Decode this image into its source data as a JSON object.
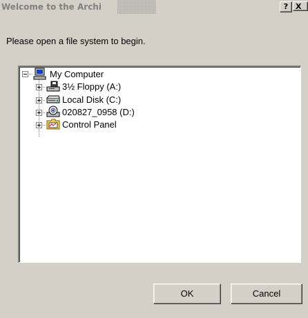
{
  "window": {
    "title": "Welcome to the Archi",
    "help_label": "?",
    "close_label": "X"
  },
  "prompt": "Please open a file system to begin.",
  "tree": {
    "root": {
      "label": "My Computer",
      "icon": "computer-icon",
      "expanded": true
    },
    "children": [
      {
        "label": "3½ Floppy (A:)",
        "icon": "floppy-drive-icon"
      },
      {
        "label": "Local Disk (C:)",
        "icon": "hard-disk-icon"
      },
      {
        "label": "020827_0958 (D:)",
        "icon": "cd-drive-icon"
      },
      {
        "label": "Control Panel",
        "icon": "control-panel-icon"
      }
    ]
  },
  "buttons": {
    "ok": "OK",
    "cancel": "Cancel"
  },
  "colors": {
    "face": "#d4d0c8",
    "title_text": "#808080",
    "tree_bg": "#ffffff"
  }
}
